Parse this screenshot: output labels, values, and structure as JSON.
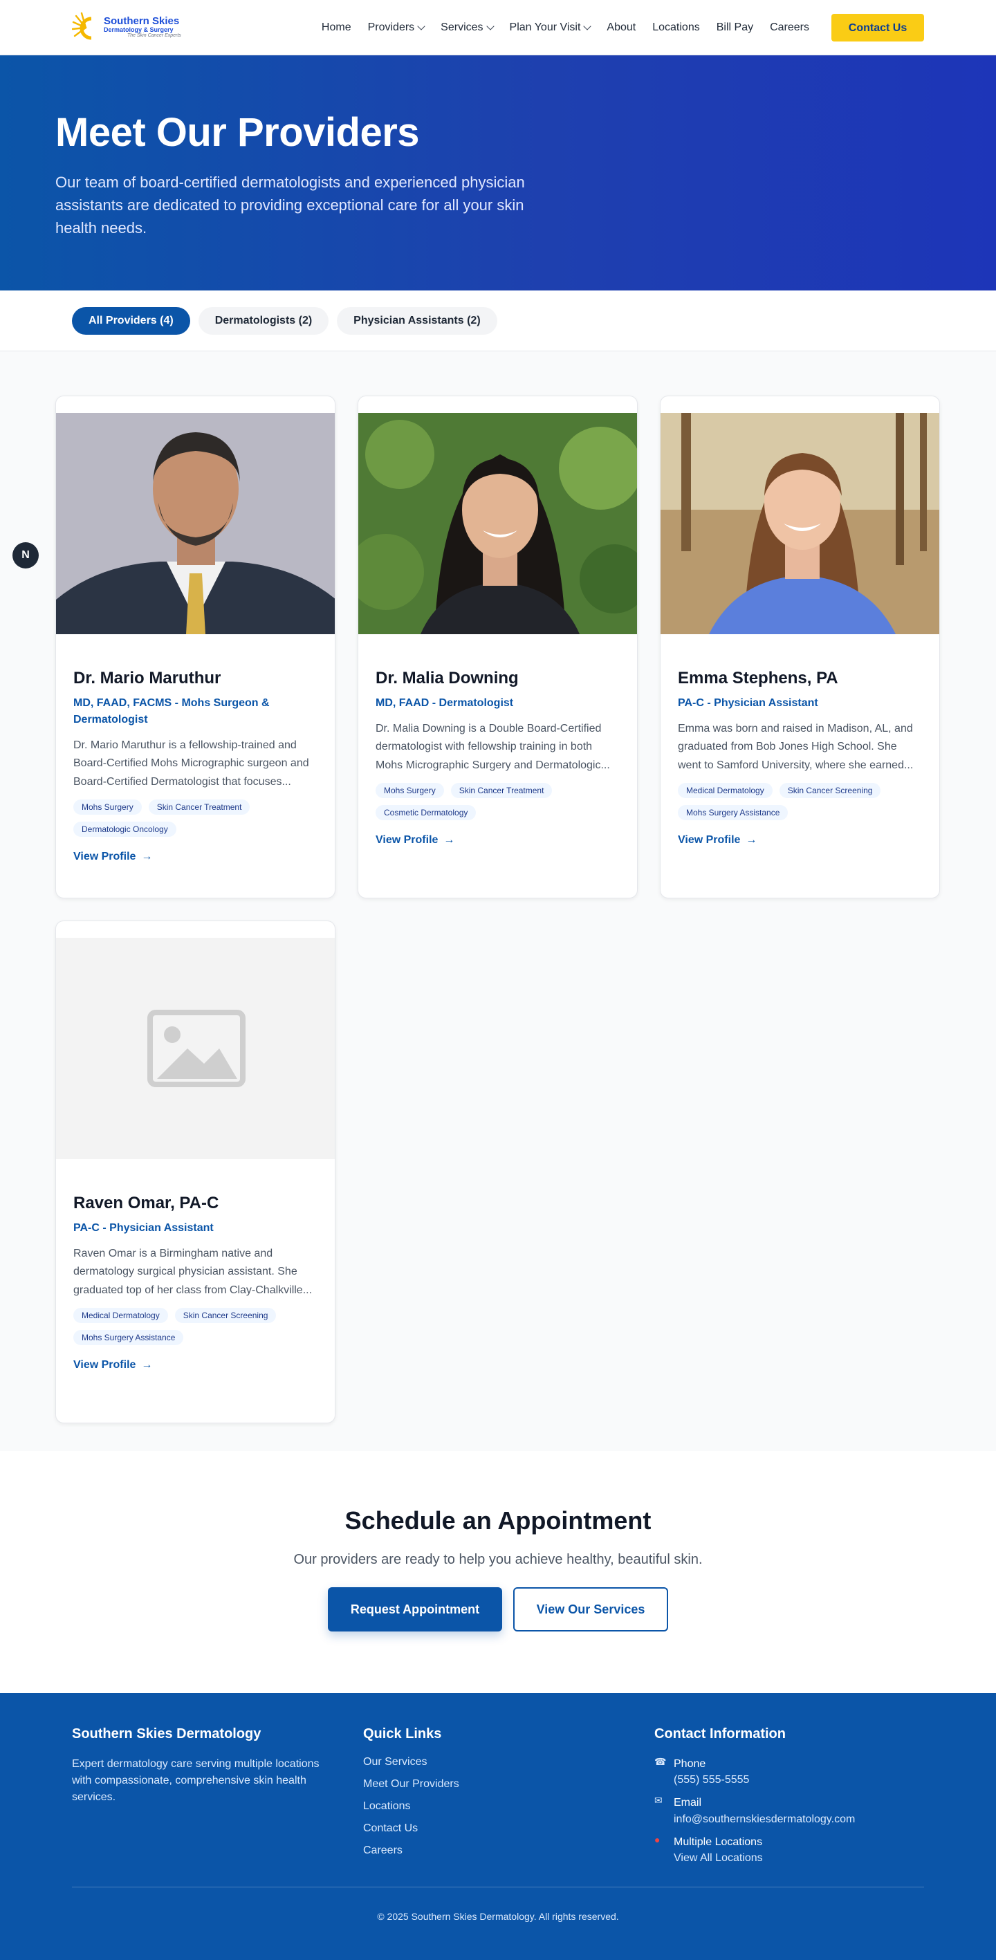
{
  "brand": {
    "name": "Southern Skies",
    "subtitle": "Dermatology & Surgery",
    "tagline": "The Skin Cancer Experts"
  },
  "nav": {
    "items": [
      {
        "label": "Home",
        "dropdown": false
      },
      {
        "label": "Providers",
        "dropdown": true
      },
      {
        "label": "Services",
        "dropdown": true
      },
      {
        "label": "Plan Your Visit",
        "dropdown": true
      },
      {
        "label": "About",
        "dropdown": false
      },
      {
        "label": "Locations",
        "dropdown": false
      },
      {
        "label": "Bill Pay",
        "dropdown": false
      },
      {
        "label": "Careers",
        "dropdown": false
      }
    ],
    "cta": "Contact Us"
  },
  "hero": {
    "title": "Meet Our Providers",
    "description": "Our team of board-certified dermatologists and experienced physician assistants are dedicated to providing exceptional care for all your skin health needs."
  },
  "filters": [
    {
      "label": "All Providers (4)",
      "active": true
    },
    {
      "label": "Dermatologists (2)",
      "active": false
    },
    {
      "label": "Physician Assistants (2)",
      "active": false
    }
  ],
  "side_badge": "N",
  "providers": [
    {
      "name": "Dr. Mario Maruthur",
      "credentials": "MD, FAAD, FACMS - Mohs Surgeon & Dermatologist",
      "bio": "Dr. Mario Maruthur is a fellowship-trained and Board-Certified Mohs Micrographic surgeon and Board-Certified Dermatologist that focuses...",
      "tags": [
        "Mohs Surgery",
        "Skin Cancer Treatment",
        "Dermatologic Oncology"
      ],
      "link": "View Profile",
      "photo": "man-suit"
    },
    {
      "name": "Dr. Malia Downing",
      "credentials": "MD, FAAD - Dermatologist",
      "bio": "Dr. Malia Downing is a Double Board-Certified dermatologist with fellowship training in both Mohs Micrographic Surgery and Dermatologic...",
      "tags": [
        "Mohs Surgery",
        "Skin Cancer Treatment",
        "Cosmetic Dermatology"
      ],
      "link": "View Profile",
      "photo": "woman-foliage"
    },
    {
      "name": "Emma Stephens, PA",
      "credentials": "PA-C - Physician Assistant",
      "bio": "Emma was born and raised in Madison, AL, and graduated from Bob Jones High School. She went to Samford University, where she earned...",
      "tags": [
        "Medical Dermatology",
        "Skin Cancer Screening",
        "Mohs Surgery Assistance"
      ],
      "link": "View Profile",
      "photo": "woman-scrubs"
    },
    {
      "name": "Raven Omar, PA-C",
      "credentials": "PA-C - Physician Assistant",
      "bio": "Raven Omar is a Birmingham native and dermatology surgical physician assistant. She graduated top of her class from Clay-Chalkville...",
      "tags": [
        "Medical Dermatology",
        "Skin Cancer Screening",
        "Mohs Surgery Assistance"
      ],
      "link": "View Profile",
      "photo": "placeholder"
    }
  ],
  "cta": {
    "title": "Schedule an Appointment",
    "subtitle": "Our providers are ready to help you achieve healthy, beautiful skin.",
    "primary": "Request Appointment",
    "secondary": "View Our Services"
  },
  "footer": {
    "about": {
      "heading": "Southern Skies Dermatology",
      "text": "Expert dermatology care serving multiple locations with compassionate, comprehensive skin health services."
    },
    "quick_links": {
      "heading": "Quick Links",
      "items": [
        "Our Services",
        "Meet Our Providers",
        "Locations",
        "Contact Us",
        "Careers"
      ]
    },
    "contact": {
      "heading": "Contact Information",
      "items": [
        {
          "icon": "phone-icon",
          "label": "Phone",
          "value": "(555) 555-5555"
        },
        {
          "icon": "email-icon",
          "label": "Email",
          "value": "info@southernskiesdermatology.com"
        },
        {
          "icon": "location-pin-icon",
          "label": "Multiple Locations",
          "value": "View All Locations"
        }
      ]
    },
    "copyright": "© 2025 Southern Skies Dermatology. All rights reserved."
  },
  "colors": {
    "primary": "#0b55a8",
    "accent": "#facc15",
    "background": "#f9fafb"
  }
}
